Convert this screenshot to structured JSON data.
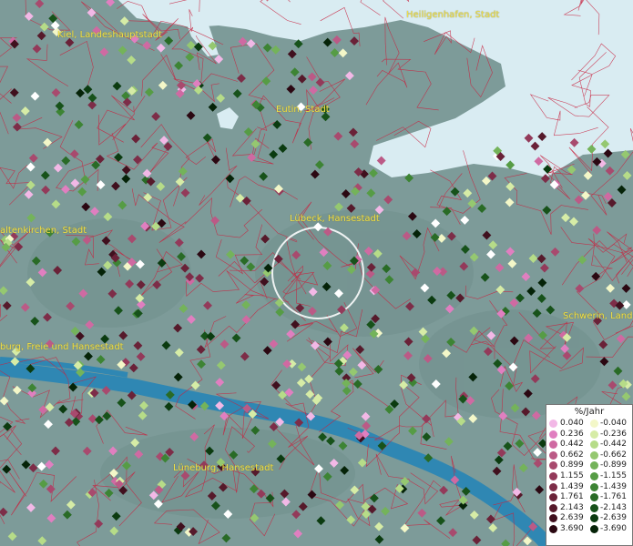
{
  "cities": [
    {
      "name": "Kiel, Landeshauptstadt"
    },
    {
      "name": "Heiligenhafen, Stadt"
    },
    {
      "name": "Eutin, Stadt"
    },
    {
      "name": "Lübeck, Hansestadt"
    },
    {
      "name": "altenkirchen, Stadt"
    },
    {
      "name": "Schwerin, Lande"
    },
    {
      "name": "burg, Freie und Hansestadt"
    },
    {
      "name": "Lüneburg, Hansestadt"
    }
  ],
  "legend": {
    "title": "%/Jahr",
    "positive": [
      {
        "label": "0.040",
        "color": "#f2b8e6"
      },
      {
        "label": "0.236",
        "color": "#e07fc0"
      },
      {
        "label": "0.442",
        "color": "#cf6aa2"
      },
      {
        "label": "0.662",
        "color": "#bb5a86"
      },
      {
        "label": "0.899",
        "color": "#a84a6e"
      },
      {
        "label": "1.155",
        "color": "#933a5a"
      },
      {
        "label": "1.439",
        "color": "#7d2d48"
      },
      {
        "label": "1.761",
        "color": "#6a2238"
      },
      {
        "label": "2.143",
        "color": "#561a2b"
      },
      {
        "label": "2.639",
        "color": "#40101e"
      },
      {
        "label": "3.690",
        "color": "#2b0812"
      }
    ],
    "negative": [
      {
        "label": "-0.040",
        "color": "#f3f7c8"
      },
      {
        "label": "-0.236",
        "color": "#d6eca6"
      },
      {
        "label": "-0.442",
        "color": "#b6dc88"
      },
      {
        "label": "-0.662",
        "color": "#95c870"
      },
      {
        "label": "-0.899",
        "color": "#74b35a"
      },
      {
        "label": "-1.155",
        "color": "#569c45"
      },
      {
        "label": "-1.439",
        "color": "#3d8434"
      },
      {
        "label": "-1.761",
        "color": "#296b26"
      },
      {
        "label": "-2.143",
        "color": "#17521a"
      },
      {
        "label": "-2.639",
        "color": "#0b3b10"
      },
      {
        "label": "-3.690",
        "color": "#052308"
      }
    ]
  }
}
